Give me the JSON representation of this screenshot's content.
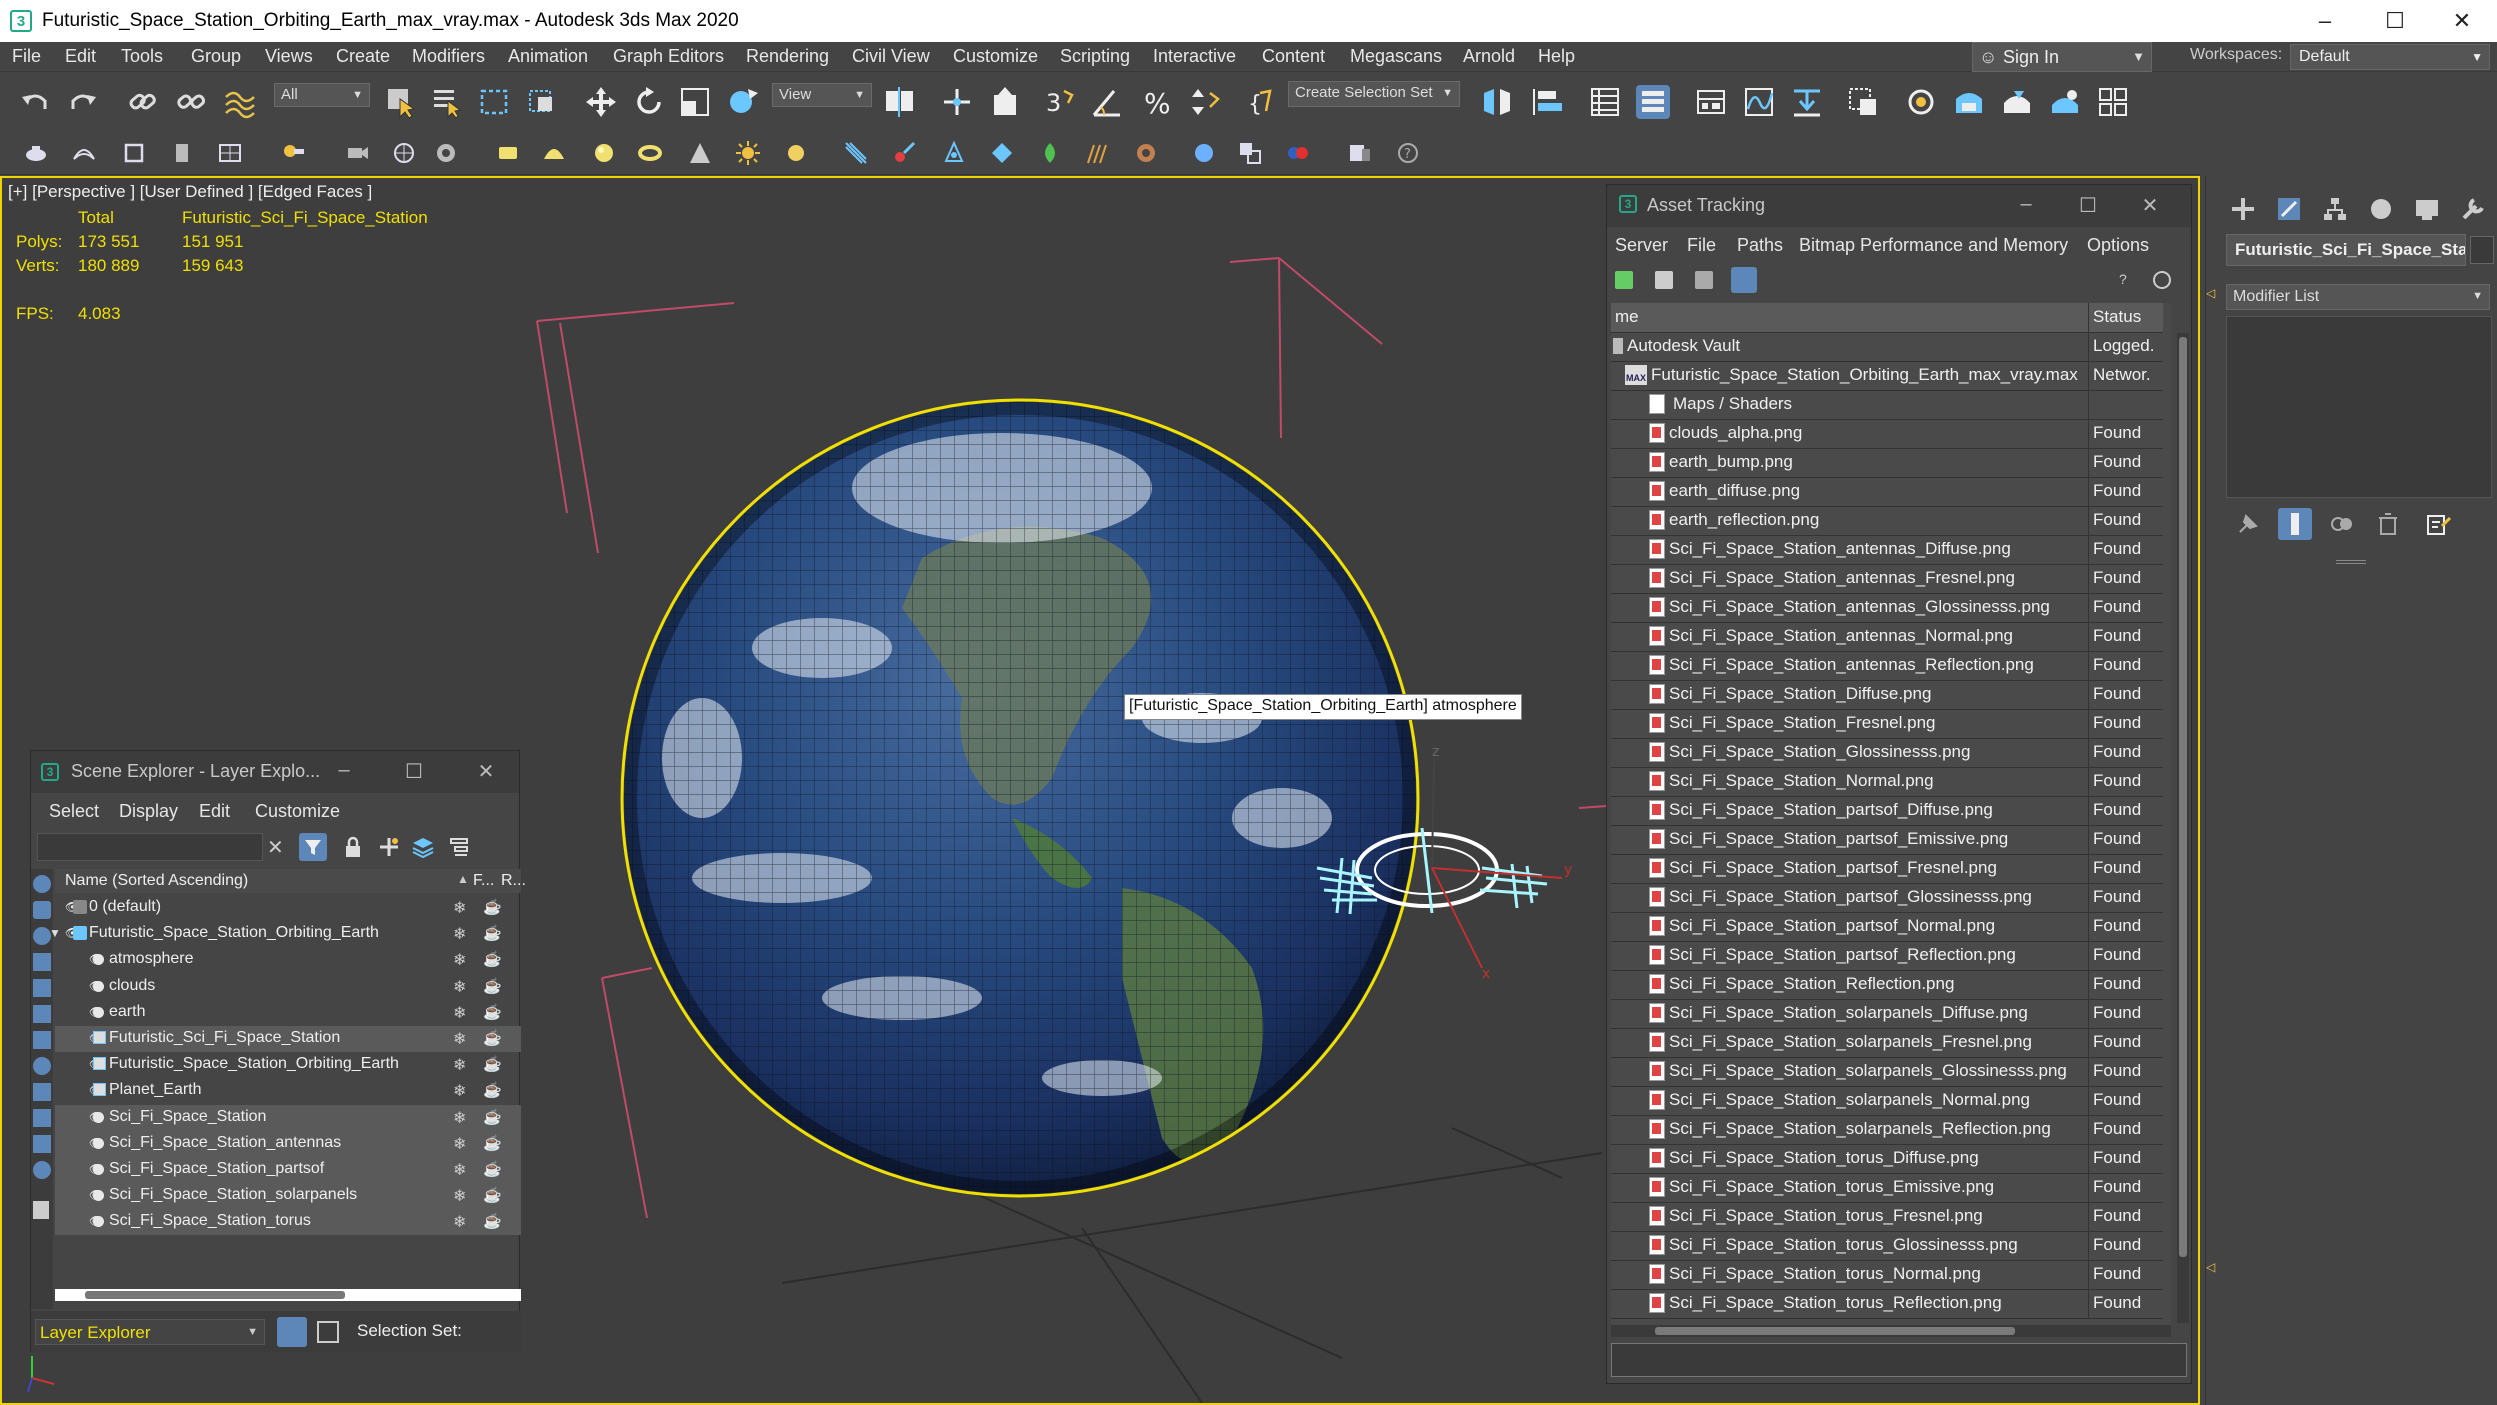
{
  "window": {
    "title": "Futuristic_Space_Station_Orbiting_Earth_max_vray.max - Autodesk 3ds Max 2020",
    "app_icon": "3"
  },
  "menu": [
    "File",
    "Edit",
    "Tools",
    "Group",
    "Views",
    "Create",
    "Modifiers",
    "Animation",
    "Graph Editors",
    "Rendering",
    "Civil View",
    "Customize",
    "Scripting",
    "Interactive",
    "Content",
    "Megascans",
    "Arnold",
    "Help"
  ],
  "signin": {
    "label": "Sign In"
  },
  "workspaces": {
    "label": "Workspaces:",
    "value": "Default"
  },
  "toolbar": {
    "filter_dropdown": "All",
    "view_dropdown": "View",
    "selection_set": "Create Selection Set"
  },
  "viewport": {
    "label": "[+] [Perspective ] [User Defined ] [Edged Faces ]",
    "stats_header_total": "Total",
    "stats_header_object": "Futuristic_Sci_Fi_Space_Station",
    "polys_label": "Polys:",
    "polys_total": "173 551",
    "polys_object": "151 951",
    "verts_label": "Verts:",
    "verts_total": "180 889",
    "verts_object": "159 643",
    "fps_label": "FPS:",
    "fps_value": "4.083",
    "tooltip": "[Futuristic_Space_Station_Orbiting_Earth] atmosphere"
  },
  "asset_tracking": {
    "title": "Asset Tracking",
    "menu": [
      "Server",
      "File",
      "Paths",
      "Bitmap Performance and Memory",
      "Options"
    ],
    "col_name": "me",
    "col_status": "Status",
    "vault": {
      "name": "Autodesk Vault",
      "status": "Logged."
    },
    "scene_file": {
      "name": "Futuristic_Space_Station_Orbiting_Earth_max_vray.max",
      "status": "Networ.",
      "icon_text": "MAX"
    },
    "group": {
      "name": "Maps / Shaders"
    },
    "files": [
      {
        "name": "clouds_alpha.png",
        "status": "Found"
      },
      {
        "name": "earth_bump.png",
        "status": "Found"
      },
      {
        "name": "earth_diffuse.png",
        "status": "Found"
      },
      {
        "name": "earth_reflection.png",
        "status": "Found"
      },
      {
        "name": "Sci_Fi_Space_Station_antennas_Diffuse.png",
        "status": "Found"
      },
      {
        "name": "Sci_Fi_Space_Station_antennas_Fresnel.png",
        "status": "Found"
      },
      {
        "name": "Sci_Fi_Space_Station_antennas_Glossinesss.png",
        "status": "Found"
      },
      {
        "name": "Sci_Fi_Space_Station_antennas_Normal.png",
        "status": "Found"
      },
      {
        "name": "Sci_Fi_Space_Station_antennas_Reflection.png",
        "status": "Found"
      },
      {
        "name": "Sci_Fi_Space_Station_Diffuse.png",
        "status": "Found"
      },
      {
        "name": "Sci_Fi_Space_Station_Fresnel.png",
        "status": "Found"
      },
      {
        "name": "Sci_Fi_Space_Station_Glossinesss.png",
        "status": "Found"
      },
      {
        "name": "Sci_Fi_Space_Station_Normal.png",
        "status": "Found"
      },
      {
        "name": "Sci_Fi_Space_Station_partsof_Diffuse.png",
        "status": "Found"
      },
      {
        "name": "Sci_Fi_Space_Station_partsof_Emissive.png",
        "status": "Found"
      },
      {
        "name": "Sci_Fi_Space_Station_partsof_Fresnel.png",
        "status": "Found"
      },
      {
        "name": "Sci_Fi_Space_Station_partsof_Glossinesss.png",
        "status": "Found"
      },
      {
        "name": "Sci_Fi_Space_Station_partsof_Normal.png",
        "status": "Found"
      },
      {
        "name": "Sci_Fi_Space_Station_partsof_Reflection.png",
        "status": "Found"
      },
      {
        "name": "Sci_Fi_Space_Station_Reflection.png",
        "status": "Found"
      },
      {
        "name": "Sci_Fi_Space_Station_solarpanels_Diffuse.png",
        "status": "Found"
      },
      {
        "name": "Sci_Fi_Space_Station_solarpanels_Fresnel.png",
        "status": "Found"
      },
      {
        "name": "Sci_Fi_Space_Station_solarpanels_Glossinesss.png",
        "status": "Found"
      },
      {
        "name": "Sci_Fi_Space_Station_solarpanels_Normal.png",
        "status": "Found"
      },
      {
        "name": "Sci_Fi_Space_Station_solarpanels_Reflection.png",
        "status": "Found"
      },
      {
        "name": "Sci_Fi_Space_Station_torus_Diffuse.png",
        "status": "Found"
      },
      {
        "name": "Sci_Fi_Space_Station_torus_Emissive.png",
        "status": "Found"
      },
      {
        "name": "Sci_Fi_Space_Station_torus_Fresnel.png",
        "status": "Found"
      },
      {
        "name": "Sci_Fi_Space_Station_torus_Glossinesss.png",
        "status": "Found"
      },
      {
        "name": "Sci_Fi_Space_Station_torus_Normal.png",
        "status": "Found"
      },
      {
        "name": "Sci_Fi_Space_Station_torus_Reflection.png",
        "status": "Found"
      }
    ]
  },
  "scene_explorer": {
    "title": "Scene Explorer - Layer Explo...",
    "menu": [
      "Select",
      "Display",
      "Edit",
      "Customize"
    ],
    "col_name": "Name (Sorted Ascending)",
    "col_freeze": "F...",
    "col_render": "R...",
    "rows": [
      {
        "label": "0 (default)",
        "kind": "layer",
        "selected": false
      },
      {
        "label": "Futuristic_Space_Station_Orbiting_Earth",
        "kind": "layer-active",
        "selected": false
      },
      {
        "label": "atmosphere",
        "kind": "object",
        "selected": false
      },
      {
        "label": "clouds",
        "kind": "object",
        "selected": false
      },
      {
        "label": "earth",
        "kind": "object",
        "selected": false
      },
      {
        "label": "Futuristic_Sci_Fi_Space_Station",
        "kind": "group",
        "selected": true
      },
      {
        "label": "Futuristic_Space_Station_Orbiting_Earth",
        "kind": "group",
        "selected": false
      },
      {
        "label": "Planet_Earth",
        "kind": "group",
        "selected": false
      },
      {
        "label": "Sci_Fi_Space_Station",
        "kind": "object",
        "selected": true
      },
      {
        "label": "Sci_Fi_Space_Station_antennas",
        "kind": "object",
        "selected": true
      },
      {
        "label": "Sci_Fi_Space_Station_partsof",
        "kind": "object",
        "selected": true
      },
      {
        "label": "Sci_Fi_Space_Station_solarpanels",
        "kind": "object",
        "selected": true
      },
      {
        "label": "Sci_Fi_Space_Station_torus",
        "kind": "object",
        "selected": true
      }
    ],
    "footer_dropdown": "Layer Explorer",
    "selection_set_label": "Selection Set:"
  },
  "command_panel": {
    "object_name": "Futuristic_Sci_Fi_Space_Sta",
    "modifier_list": "Modifier List"
  },
  "colors": {
    "viewport_border": "#f0d400",
    "sphere_outline": "#f0e000",
    "stats_yellow": "#f0e000",
    "camera_lines": "#c04a6a",
    "station": "#a8f4ff"
  }
}
